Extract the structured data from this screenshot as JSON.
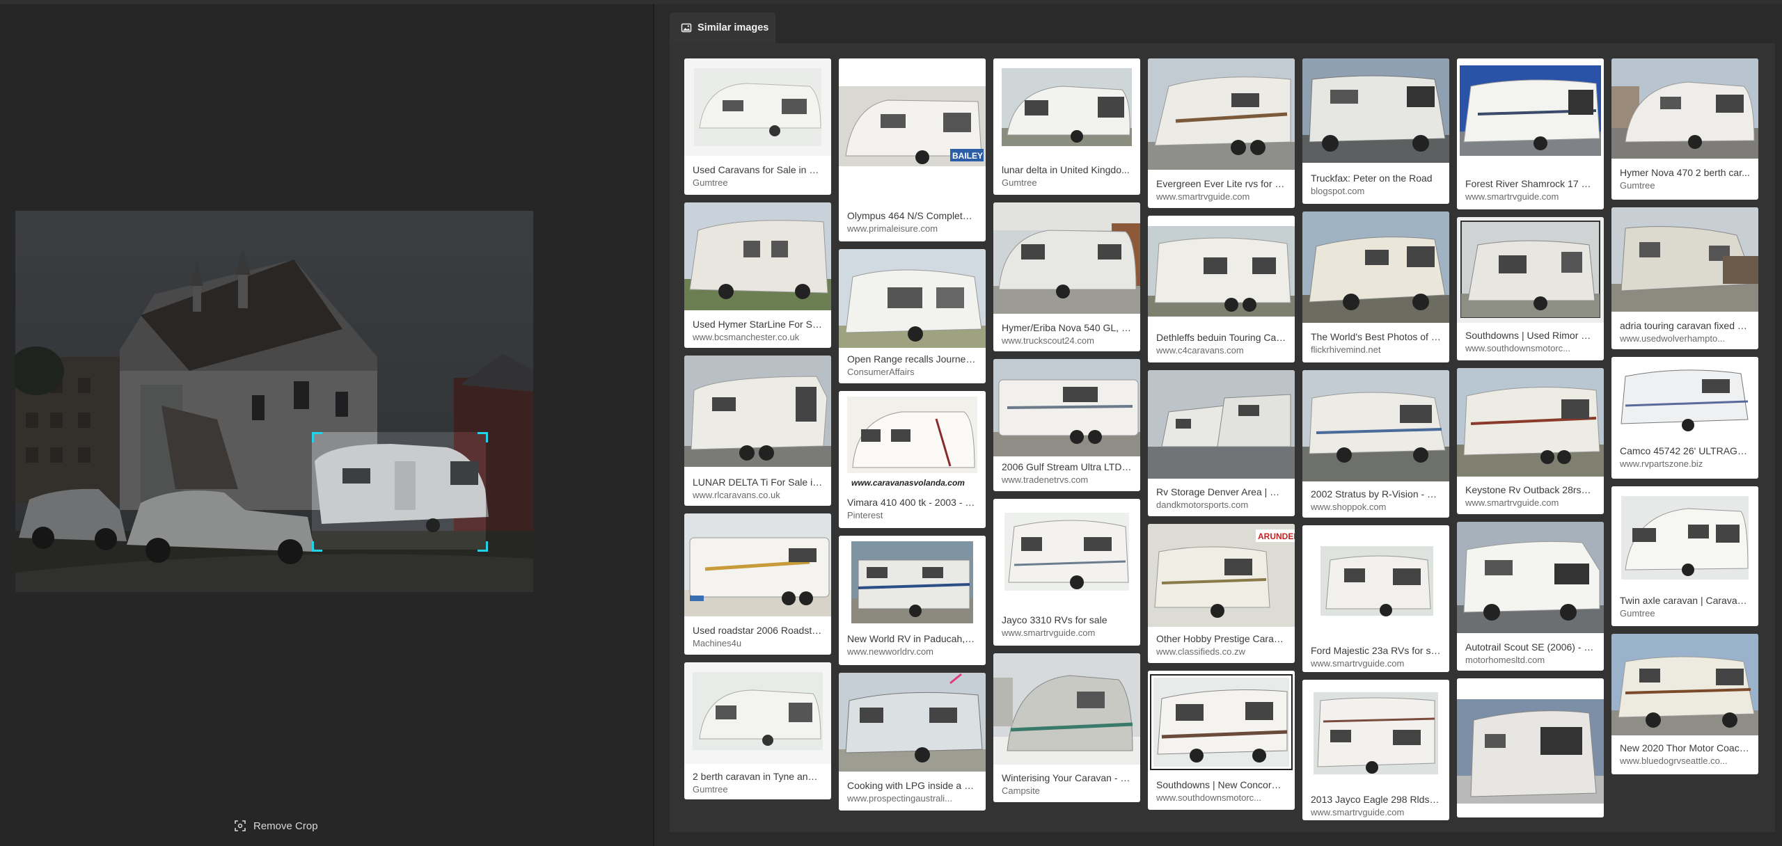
{
  "ui": {
    "remove_crop_label": "Remove Crop",
    "panel_tab_label": "Similar images",
    "accent_color": "#22d3e8"
  },
  "results": [
    {
      "caption": "Used Caravans for Sale in Hu...",
      "source": "Gumtree"
    },
    {
      "caption": "Used Hymer StarLine For Sal...",
      "source": "www.bcsmanchester.co.uk"
    },
    {
      "caption": "LUNAR DELTA Ti For Sale in ...",
      "source": "www.rlcaravans.co.uk"
    },
    {
      "caption": "Used roadstar 2006 Roadsta...",
      "source": "Machines4u"
    },
    {
      "caption": "2 berth caravan in Tyne and ...",
      "source": "Gumtree"
    },
    {
      "caption": "Olympus 464 N/S Complete ...",
      "source": "www.primaleisure.com"
    },
    {
      "caption": "Open Range recalls Journeye...",
      "source": "ConsumerAffairs"
    },
    {
      "caption": "Vimara 410 400 tk - 2003 - 6...",
      "source": "Pinterest"
    },
    {
      "caption": "New World RV in Paducah, K...",
      "source": "www.newworldrv.com"
    },
    {
      "caption": "Cooking with LPG inside a C...",
      "source": "www.prospectingaustrali..."
    },
    {
      "caption": "lunar delta in United Kingdo...",
      "source": "Gumtree"
    },
    {
      "caption": "Hymer/Eriba Nova 540 GL, C...",
      "source": "www.truckscout24.com"
    },
    {
      "caption": "2006 Gulf Stream Ultra LTD i...",
      "source": "www.tradenetrvs.com"
    },
    {
      "caption": "Jayco 3310 RVs for sale",
      "source": "www.smartrvguide.com"
    },
    {
      "caption": "Winterising Your Caravan - U...",
      "source": "Campsite"
    },
    {
      "caption": "Evergreen Ever Lite rvs for sa...",
      "source": "www.smartrvguide.com"
    },
    {
      "caption": "Dethleffs beduin Touring Car...",
      "source": "www.c4caravans.com"
    },
    {
      "caption": "Rv Storage Denver Area | Dan...",
      "source": "dandkmotorsports.com"
    },
    {
      "caption": "Other Hobby Prestige Carava...",
      "source": "www.classifieds.co.zw"
    },
    {
      "caption": "Southdowns | New Concorde...",
      "source": "www.southdownsmotorc..."
    },
    {
      "caption": "Truckfax: Peter on the Road",
      "source": "blogspot.com"
    },
    {
      "caption": "The World's Best Photos of e...",
      "source": "flickrhivemind.net"
    },
    {
      "caption": "2002 Stratus by R-Vision - $2...",
      "source": "www.shoppok.com"
    },
    {
      "caption": "Ford Majestic 23a RVs for sale",
      "source": "www.smartrvguide.com"
    },
    {
      "caption": "2013 Jayco Eagle 298 Rlds R...",
      "source": "www.smartrvguide.com"
    },
    {
      "caption": "Forest River Shamrock 17 RV...",
      "source": "www.smartrvguide.com"
    },
    {
      "caption": "Southdowns | Used Rimor Sa...",
      "source": "www.southdownsmotorc..."
    },
    {
      "caption": "Keystone Rv Outback 28rsds ...",
      "source": "www.smartrvguide.com"
    },
    {
      "caption": "Autotrail Scout SE (2006) - M...",
      "source": "motorhomesltd.com"
    },
    {
      "caption": "",
      "source": ""
    },
    {
      "caption": "Hymer Nova 470 2 berth car...",
      "source": "Gumtree"
    },
    {
      "caption": "adria touring caravan fixed b...",
      "source": "www.usedwolverhampto..."
    },
    {
      "caption": "Camco 45742 26' ULTRAGua...",
      "source": "www.rvpartszone.biz"
    },
    {
      "caption": "Twin axle caravan | Caravans...",
      "source": "Gumtree"
    },
    {
      "caption": "New 2020 Thor Motor Coach...",
      "source": "www.bluedogrvseattle.co..."
    }
  ],
  "thumb_texts": {
    "bailey_logo": "BAILEY",
    "vimara_watermark": "www.caravanasvolanda.com",
    "arundel_sign": "ARUNDEL"
  }
}
